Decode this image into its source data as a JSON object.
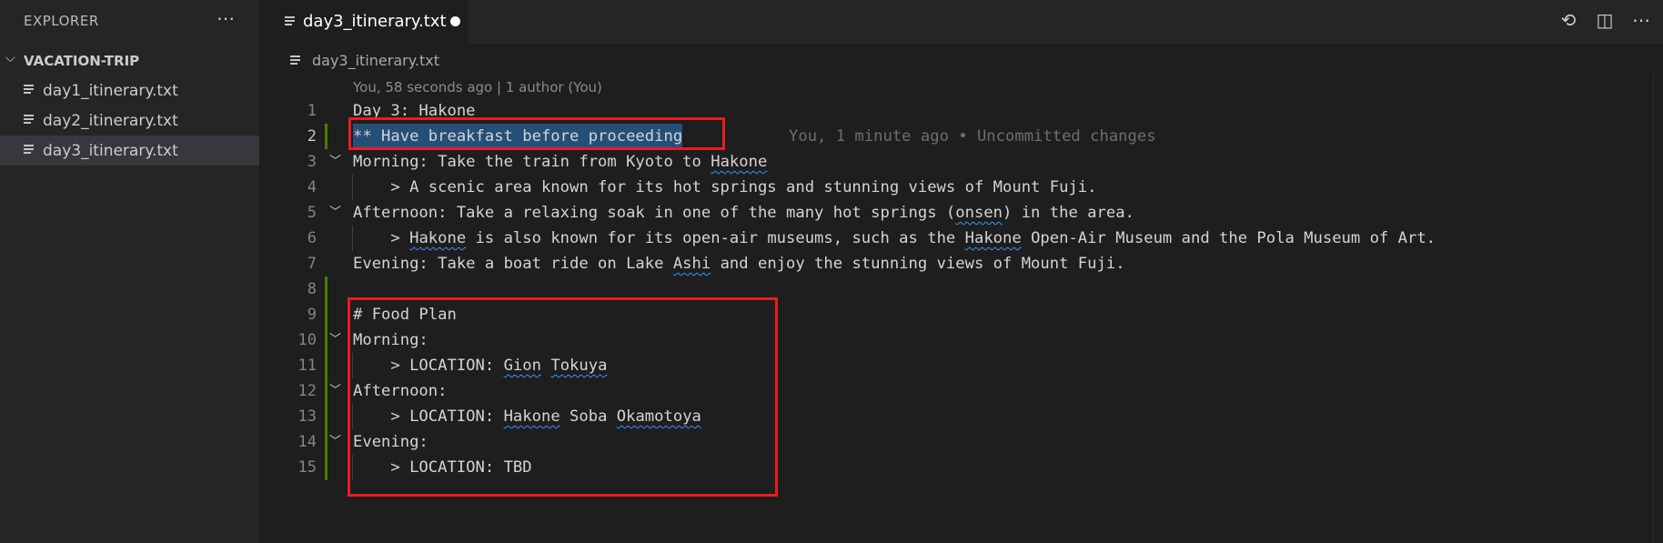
{
  "sidebar": {
    "title": "EXPLORER",
    "more_icon": "ellipsis-icon",
    "folder": "VACATION-TRIP",
    "files": [
      {
        "label": "day1_itinerary.txt"
      },
      {
        "label": "day2_itinerary.txt"
      },
      {
        "label": "day3_itinerary.txt"
      }
    ]
  },
  "tab": {
    "label": "day3_itinerary.txt"
  },
  "breadcrumb": {
    "label": "day3_itinerary.txt"
  },
  "codelens": "You, 58 seconds ago | 1 author (You)",
  "blame": "You, 1 minute ago • Uncommitted changes",
  "lines": [
    {
      "n": "1",
      "text": "Day 3: Hakone"
    },
    {
      "n": "2",
      "text": "** Have breakfast before proceeding"
    },
    {
      "n": "3",
      "text": "Morning: Take the train from Kyoto to Hakone"
    },
    {
      "n": "4",
      "text": "    > A scenic area known for its hot springs and stunning views of Mount Fuji."
    },
    {
      "n": "5",
      "text": "Afternoon: Take a relaxing soak in one of the many hot springs (onsen) in the area."
    },
    {
      "n": "6",
      "text": "    > Hakone is also known for its open-air museums, such as the Hakone Open-Air Museum and the Pola Museum of Art."
    },
    {
      "n": "7",
      "text": "Evening: Take a boat ride on Lake Ashi and enjoy the stunning views of Mount Fuji."
    },
    {
      "n": "8",
      "text": ""
    },
    {
      "n": "9",
      "text": "# Food Plan"
    },
    {
      "n": "10",
      "text": "Morning:"
    },
    {
      "n": "11",
      "text": "    > LOCATION: Gion Tokuya"
    },
    {
      "n": "12",
      "text": "Afternoon:"
    },
    {
      "n": "13",
      "text": "    > LOCATION: Hakone Soba Okamotoya"
    },
    {
      "n": "14",
      "text": "Evening:"
    },
    {
      "n": "15",
      "text": "    > LOCATION: TBD"
    }
  ],
  "colors": {
    "accent_annotation": "#e81c23",
    "selection": "#264f78",
    "git_added": "#487e02"
  }
}
